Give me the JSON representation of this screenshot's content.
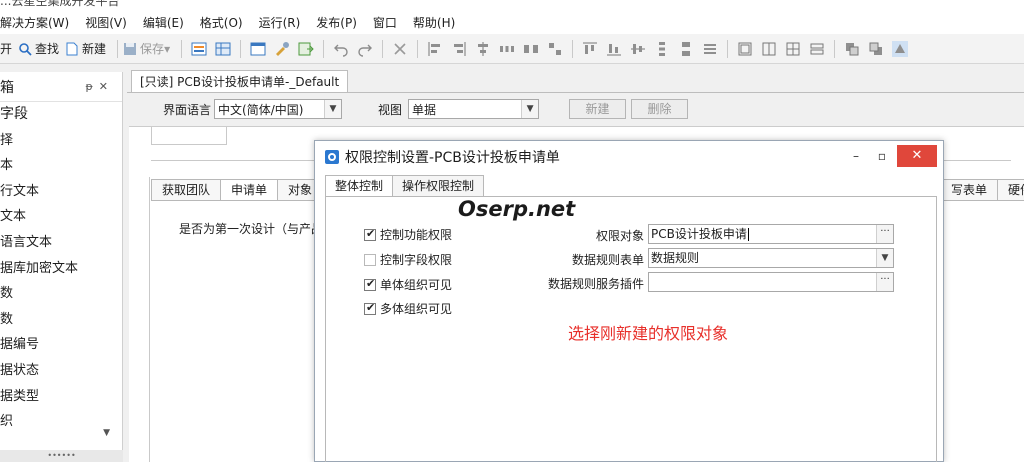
{
  "window": {
    "title": "...云星空集成开发平台"
  },
  "menu": [
    "解决方案(W)",
    "视图(V)",
    "编辑(E)",
    "格式(O)",
    "运行(R)",
    "发布(P)",
    "窗口",
    "帮助(H)"
  ],
  "toolbar": {
    "open": "开",
    "find": "查找",
    "new": "新建",
    "save": "保存",
    "save_arrow": "▾"
  },
  "toolbox": {
    "title": "箱",
    "pin": "ᵽ",
    "close": "✕",
    "items": [
      "字段",
      "择",
      "本",
      "行文本",
      "文本",
      "语言文本",
      "据库加密文本",
      "数",
      "数",
      "据编号",
      "据状态",
      "据类型",
      "织"
    ],
    "scroll_down": "▼",
    "grip": "••••••"
  },
  "document": {
    "tab_label": "[只读] PCB设计投板申请单-_Default",
    "language_label": "界面语言",
    "language_value": "中文(简体/中国)",
    "view_label": "视图",
    "view_value": "单据",
    "new_button": "新建",
    "delete_button": "删除",
    "inner_tabs": [
      "获取团队",
      "申请单",
      "对象"
    ],
    "right_tabs": [
      "写表单",
      "硬件"
    ],
    "question_text": "是否为第一次设计（与产品"
  },
  "dialog": {
    "title": "权限控制设置-PCB设计投板申请单",
    "minimize": "–",
    "maximize": "▫",
    "close": "✕",
    "tabs": [
      "整体控制",
      "操作权限控制"
    ],
    "checkboxes": [
      {
        "label": "控制功能权限",
        "checked": true
      },
      {
        "label": "控制字段权限",
        "checked": false
      },
      {
        "label": "单体组织可见",
        "checked": true
      },
      {
        "label": "多体组织可见",
        "checked": true
      }
    ],
    "permission_object_label": "权限对象",
    "permission_object_value": "PCB设计投板申请",
    "rule_form_label": "数据规则表单",
    "rule_form_value": "数据规则",
    "rule_plugin_label": "数据规则服务插件",
    "rule_plugin_value": "",
    "ellipsis": "···"
  },
  "overlay": {
    "watermark": "Oserp.net",
    "annotation": "选择刚新建的权限对象",
    "highlight_color": "#e25050",
    "annotation_color": "#e8302b"
  }
}
